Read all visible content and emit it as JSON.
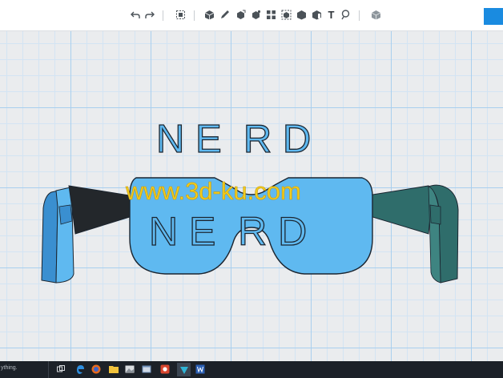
{
  "toolbar": {
    "tools": [
      {
        "name": "undo-icon"
      },
      {
        "name": "redo-icon"
      },
      {
        "name": "group-icon"
      },
      {
        "name": "primitive-box-icon"
      },
      {
        "name": "sketch-icon"
      },
      {
        "name": "construct-icon"
      },
      {
        "name": "modify-icon"
      },
      {
        "name": "pattern-icon"
      },
      {
        "name": "grouping-icon"
      },
      {
        "name": "combine-icon"
      },
      {
        "name": "measure-icon"
      },
      {
        "name": "material-icon"
      },
      {
        "name": "text-icon",
        "glyph": "T"
      },
      {
        "name": "snap-icon"
      },
      {
        "name": "view-cube-icon"
      }
    ]
  },
  "scene": {
    "floating_text": "N E  R D",
    "lens_text": "N E  R D",
    "watermark": "www.3d-ku.com"
  },
  "taskbar": {
    "search_text": "ything."
  },
  "colors": {
    "model_blue": "#5fb9f0",
    "model_blue_dark": "#3a8fd0",
    "outline": "#1b2530",
    "arm_black": "#23272b",
    "arm_teal": "#2f6d6b",
    "watermark": "#f2cc1c",
    "taskbar": "#1c2128",
    "accent": "#1a8be0"
  }
}
